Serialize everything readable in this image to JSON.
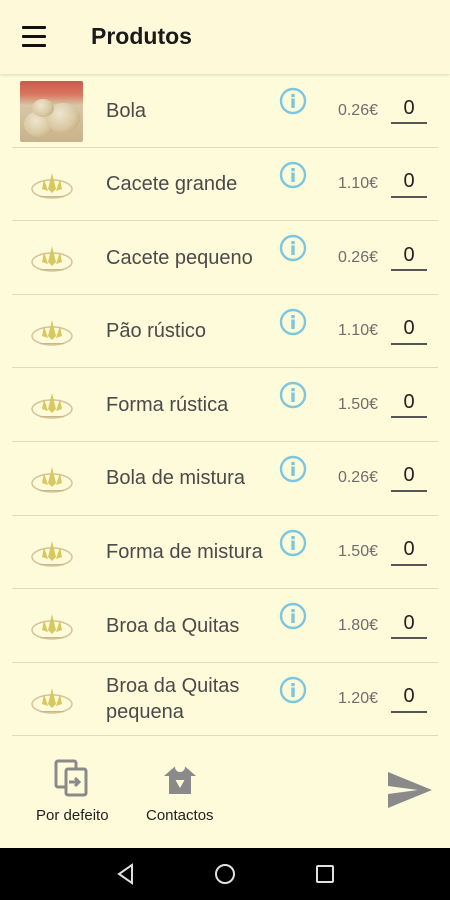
{
  "header": {
    "title": "Produtos",
    "menu_icon": "hamburger-menu-icon"
  },
  "colors": {
    "background": "#fefbdb",
    "info_icon": "#7cc6e0",
    "icon_gray": "#8a8a8a"
  },
  "products": [
    {
      "name": "Bola",
      "price": "0.26€",
      "quantity": "0",
      "image": "photo"
    },
    {
      "name": "Cacete grande",
      "price": "1.10€",
      "quantity": "0",
      "image": "logo"
    },
    {
      "name": "Cacete pequeno",
      "price": "0.26€",
      "quantity": "0",
      "image": "logo"
    },
    {
      "name": "Pão rústico",
      "price": "1.10€",
      "quantity": "0",
      "image": "logo"
    },
    {
      "name": "Forma rústica",
      "price": "1.50€",
      "quantity": "0",
      "image": "logo"
    },
    {
      "name": "Bola de mistura",
      "price": "0.26€",
      "quantity": "0",
      "image": "logo"
    },
    {
      "name": "Forma de mistura",
      "price": "1.50€",
      "quantity": "0",
      "image": "logo"
    },
    {
      "name": "Broa da Quitas",
      "price": "1.80€",
      "quantity": "0",
      "image": "logo"
    },
    {
      "name": "Broa da Quitas pequena",
      "price": "1.20€",
      "quantity": "0",
      "image": "logo"
    }
  ],
  "bottom_bar": {
    "default_label": "Por defeito",
    "default_icon": "swap-screen-icon",
    "contacts_label": "Contactos",
    "contacts_icon": "home-location-icon",
    "send_icon": "send-icon"
  },
  "system_nav": {
    "back_icon": "back-triangle-icon",
    "home_icon": "home-circle-icon",
    "recents_icon": "recents-square-icon"
  }
}
